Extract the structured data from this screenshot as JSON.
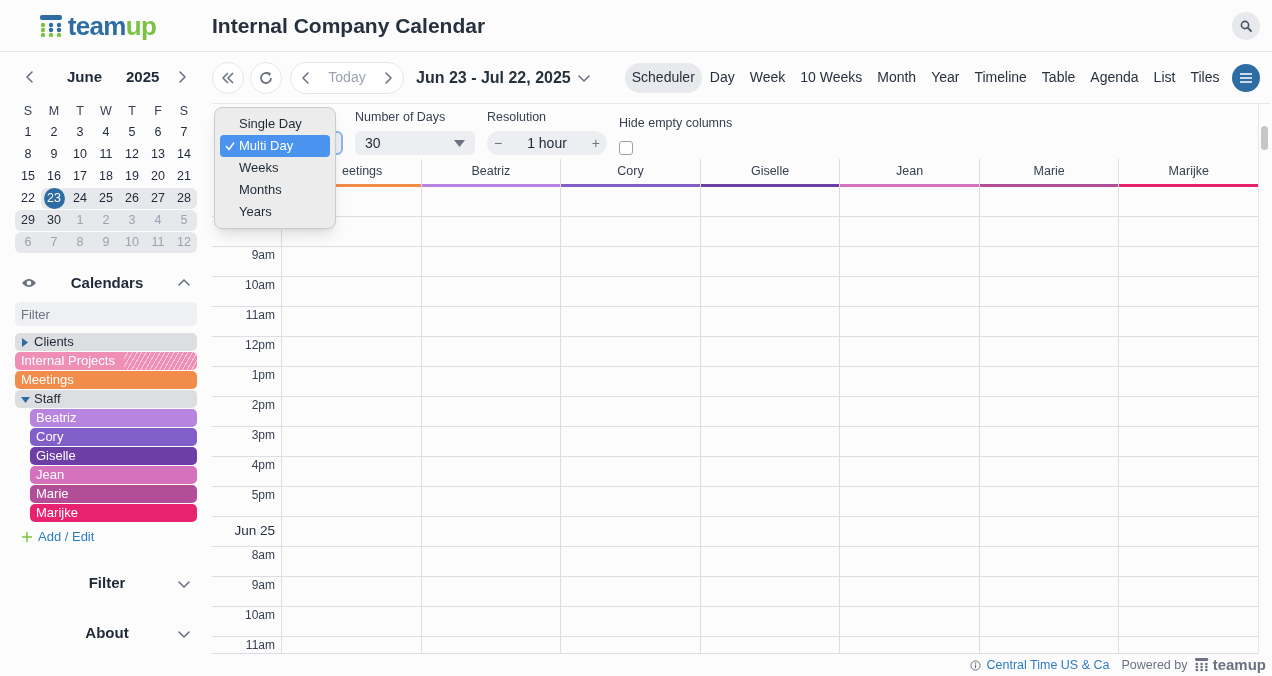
{
  "header": {
    "logo": [
      "team",
      "up"
    ],
    "title": "Internal Company Calendar"
  },
  "mini_calendar": {
    "month": "June",
    "year": "2025",
    "weekdays": [
      "S",
      "M",
      "T",
      "W",
      "T",
      "F",
      "S"
    ],
    "weeks": [
      [
        {
          "day": "1",
          "outside": false,
          "in_range": false,
          "selected": false
        },
        {
          "day": "2",
          "outside": false,
          "in_range": false,
          "selected": false
        },
        {
          "day": "3",
          "outside": false,
          "in_range": false,
          "selected": false
        },
        {
          "day": "4",
          "outside": false,
          "in_range": false,
          "selected": false
        },
        {
          "day": "5",
          "outside": false,
          "in_range": false,
          "selected": false
        },
        {
          "day": "6",
          "outside": false,
          "in_range": false,
          "selected": false
        },
        {
          "day": "7",
          "outside": false,
          "in_range": false,
          "selected": false
        }
      ],
      [
        {
          "day": "8",
          "outside": false,
          "in_range": false,
          "selected": false
        },
        {
          "day": "9",
          "outside": false,
          "in_range": false,
          "selected": false
        },
        {
          "day": "10",
          "outside": false,
          "in_range": false,
          "selected": false
        },
        {
          "day": "11",
          "outside": false,
          "in_range": false,
          "selected": false
        },
        {
          "day": "12",
          "outside": false,
          "in_range": false,
          "selected": false
        },
        {
          "day": "13",
          "outside": false,
          "in_range": false,
          "selected": false
        },
        {
          "day": "14",
          "outside": false,
          "in_range": false,
          "selected": false
        }
      ],
      [
        {
          "day": "15",
          "outside": false,
          "in_range": false,
          "selected": false
        },
        {
          "day": "16",
          "outside": false,
          "in_range": false,
          "selected": false
        },
        {
          "day": "17",
          "outside": false,
          "in_range": false,
          "selected": false
        },
        {
          "day": "18",
          "outside": false,
          "in_range": false,
          "selected": false
        },
        {
          "day": "19",
          "outside": false,
          "in_range": false,
          "selected": false
        },
        {
          "day": "20",
          "outside": false,
          "in_range": false,
          "selected": false
        },
        {
          "day": "21",
          "outside": false,
          "in_range": false,
          "selected": false
        }
      ],
      [
        {
          "day": "22",
          "outside": false,
          "in_range": false,
          "selected": false
        },
        {
          "day": "23",
          "outside": false,
          "in_range": true,
          "selected": true
        },
        {
          "day": "24",
          "outside": false,
          "in_range": true,
          "selected": false
        },
        {
          "day": "25",
          "outside": false,
          "in_range": true,
          "selected": false
        },
        {
          "day": "26",
          "outside": false,
          "in_range": true,
          "selected": false
        },
        {
          "day": "27",
          "outside": false,
          "in_range": true,
          "selected": false
        },
        {
          "day": "28",
          "outside": false,
          "in_range": true,
          "selected": false
        }
      ],
      [
        {
          "day": "29",
          "outside": false,
          "in_range": true,
          "selected": false
        },
        {
          "day": "30",
          "outside": false,
          "in_range": true,
          "selected": false
        },
        {
          "day": "1",
          "outside": true,
          "in_range": true,
          "selected": false
        },
        {
          "day": "2",
          "outside": true,
          "in_range": true,
          "selected": false
        },
        {
          "day": "3",
          "outside": true,
          "in_range": true,
          "selected": false
        },
        {
          "day": "4",
          "outside": true,
          "in_range": true,
          "selected": false
        },
        {
          "day": "5",
          "outside": true,
          "in_range": true,
          "selected": false
        }
      ],
      [
        {
          "day": "6",
          "outside": true,
          "in_range": true,
          "selected": false
        },
        {
          "day": "7",
          "outside": true,
          "in_range": true,
          "selected": false
        },
        {
          "day": "8",
          "outside": true,
          "in_range": true,
          "selected": false
        },
        {
          "day": "9",
          "outside": true,
          "in_range": true,
          "selected": false
        },
        {
          "day": "10",
          "outside": true,
          "in_range": true,
          "selected": false
        },
        {
          "day": "11",
          "outside": true,
          "in_range": true,
          "selected": false
        },
        {
          "day": "12",
          "outside": true,
          "in_range": true,
          "selected": false
        }
      ]
    ]
  },
  "calendars": {
    "title": "Calendars",
    "expanded": true,
    "filter_placeholder": "Filter",
    "items": [
      {
        "kind": "group",
        "label": "Clients",
        "expanded": false
      },
      {
        "kind": "calendar",
        "label": "Internal Projects",
        "color": "#ef8fb5",
        "hatched": true
      },
      {
        "kind": "calendar",
        "label": "Meetings",
        "color": "#f28c4b",
        "hatched": false
      },
      {
        "kind": "group",
        "label": "Staff",
        "expanded": true,
        "children": [
          {
            "kind": "calendar",
            "label": "Beatriz",
            "color": "#b784e0",
            "hatched": false
          },
          {
            "kind": "calendar",
            "label": "Cory",
            "color": "#8060c8",
            "hatched": false
          },
          {
            "kind": "calendar",
            "label": "Giselle",
            "color": "#6c3ea6",
            "hatched": false
          },
          {
            "kind": "calendar",
            "label": "Jean",
            "color": "#d672bd",
            "hatched": false
          },
          {
            "kind": "calendar",
            "label": "Marie",
            "color": "#b24e98",
            "hatched": false
          },
          {
            "kind": "calendar",
            "label": "Marijke",
            "color": "#e8226e",
            "hatched": false
          }
        ]
      }
    ],
    "add_edit": "Add / Edit"
  },
  "sidebar_sections": [
    {
      "title": "Filter",
      "expanded": false
    },
    {
      "title": "About",
      "expanded": false
    }
  ],
  "toolbar": {
    "today": "Today",
    "date_range": "Jun 23 - Jul 22, 2025",
    "views": [
      {
        "label": "Scheduler",
        "selected": true
      },
      {
        "label": "Day",
        "selected": false
      },
      {
        "label": "Week",
        "selected": false
      },
      {
        "label": "10 Weeks",
        "selected": false
      },
      {
        "label": "Month",
        "selected": false
      },
      {
        "label": "Year",
        "selected": false
      },
      {
        "label": "Timeline",
        "selected": false
      },
      {
        "label": "Table",
        "selected": false
      },
      {
        "label": "Agenda",
        "selected": false
      },
      {
        "label": "List",
        "selected": false
      },
      {
        "label": "Tiles",
        "selected": false
      }
    ]
  },
  "options": {
    "mode_menu": [
      {
        "label": "Single Day",
        "selected": false
      },
      {
        "label": "Multi Day",
        "selected": true
      },
      {
        "label": "Weeks",
        "selected": false
      },
      {
        "label": "Months",
        "selected": false
      },
      {
        "label": "Years",
        "selected": false
      }
    ],
    "number_of_days": {
      "label": "Number of Days",
      "value": "30"
    },
    "resolution": {
      "label": "Resolution",
      "value": "1 hour",
      "minus": "−",
      "plus": "+"
    },
    "hide_empty": {
      "label": "Hide empty columns",
      "checked": false
    }
  },
  "scheduler": {
    "columns": [
      {
        "label": "eetings",
        "color": "#f28c4b"
      },
      {
        "label": "Beatriz",
        "color": "#b784e0"
      },
      {
        "label": "Cory",
        "color": "#8060c8"
      },
      {
        "label": "Giselle",
        "color": "#6c3ea6"
      },
      {
        "label": "Jean",
        "color": "#d672bd"
      },
      {
        "label": "Marie",
        "color": "#b24e98"
      },
      {
        "label": "Marijke",
        "color": "#e8226e"
      }
    ],
    "rows": [
      {
        "kind": "hidden"
      },
      {
        "kind": "hidden"
      },
      {
        "kind": "time",
        "label": "9am"
      },
      {
        "kind": "time",
        "label": "10am"
      },
      {
        "kind": "time",
        "label": "11am"
      },
      {
        "kind": "time",
        "label": "12pm"
      },
      {
        "kind": "time",
        "label": "1pm"
      },
      {
        "kind": "time",
        "label": "2pm"
      },
      {
        "kind": "time",
        "label": "3pm"
      },
      {
        "kind": "time",
        "label": "4pm"
      },
      {
        "kind": "time",
        "label": "5pm"
      },
      {
        "kind": "date",
        "label": "Jun 25"
      },
      {
        "kind": "time",
        "label": "8am"
      },
      {
        "kind": "time",
        "label": "9am"
      },
      {
        "kind": "time",
        "label": "10am"
      },
      {
        "kind": "time",
        "label": "11am"
      }
    ]
  },
  "footer": {
    "timezone": "Central Time US & Ca",
    "powered_by": "Powered by",
    "logo": "teamup"
  }
}
